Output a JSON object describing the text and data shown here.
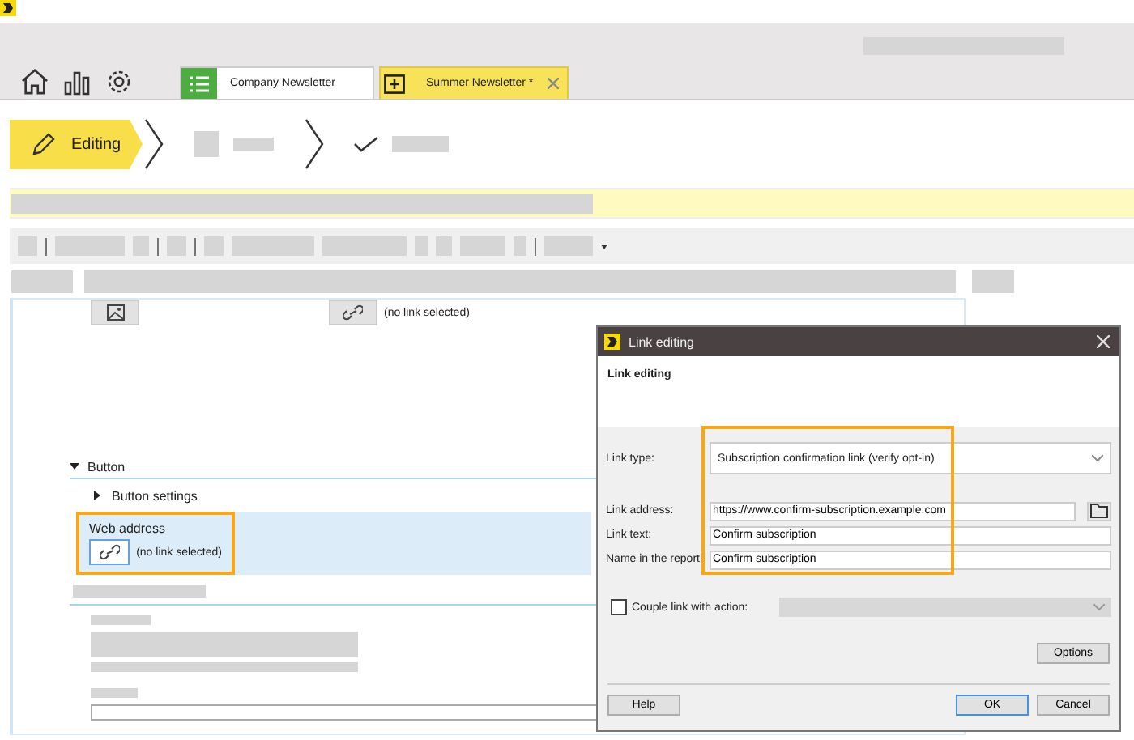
{
  "tabs": [
    {
      "label": "Company Newsletter",
      "kind": "list",
      "selected": false
    },
    {
      "label": "Summer Newsletter *",
      "kind": "new",
      "selected": true
    }
  ],
  "steps": [
    {
      "label": "Editing",
      "selected": true
    }
  ],
  "editor": {
    "image_link_text": "(no link selected)",
    "section": {
      "title": "Button",
      "expanded": true
    },
    "subsection": {
      "title": "Button settings",
      "expanded": false
    },
    "field": {
      "label": "Web address",
      "value": "(no link selected)",
      "selected": true,
      "highlighted": true
    }
  },
  "dialog": {
    "title": "Link editing",
    "heading": "Link editing",
    "highlighted": true,
    "fields": [
      {
        "label": "Link type:",
        "kind": "select",
        "value": "Subscription confirmation link (verify opt-in)"
      },
      {
        "label": "Link address:",
        "kind": "browse",
        "value": "https://www.confirm-subscription.example.com"
      },
      {
        "label": "Link text:",
        "kind": "text",
        "value": "Confirm subscription"
      },
      {
        "label": "Name in the report:",
        "kind": "text",
        "value": "Confirm subscription"
      }
    ],
    "couple": {
      "label": "Couple link with action:",
      "checked": false
    },
    "options_button": "Options",
    "footer_buttons": [
      {
        "label": "Help",
        "kind": "left"
      },
      {
        "label": "OK",
        "kind": "default"
      },
      {
        "label": "Cancel",
        "kind": "normal"
      }
    ]
  }
}
